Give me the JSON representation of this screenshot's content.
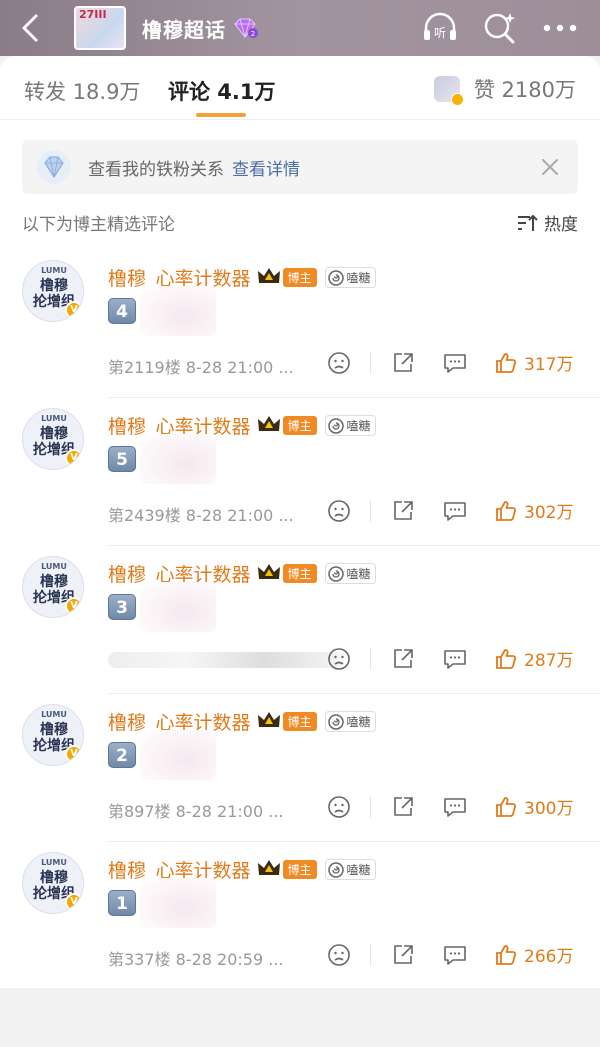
{
  "header": {
    "thumb_text": "27III",
    "title": "橹穆超话",
    "icons": [
      "back-arrow-icon",
      "listen-icon",
      "search-sparkle-icon",
      "more-icon"
    ],
    "listen_label": "听"
  },
  "tabs": {
    "repost": "转发 18.9万",
    "comment": "评论 4.1万",
    "likes": "赞 2180万"
  },
  "notice": {
    "text": "查看我的铁粉关系",
    "link": "查看详情"
  },
  "sort": {
    "hint": "以下为博主精选评论",
    "label": "热度"
  },
  "comments": [
    {
      "name": "橹穆_心率计数器",
      "tag": "博主",
      "candy": "嗑糖",
      "num": "4",
      "meta": "第2119楼 8-28 21:00 ...",
      "likes": "317万",
      "blurred": false
    },
    {
      "name": "橹穆_心率计数器",
      "tag": "博主",
      "candy": "嗑糖",
      "num": "5",
      "meta": "第2439楼 8-28 21:00 ...",
      "likes": "302万",
      "blurred": false
    },
    {
      "name": "橹穆_心率计数器",
      "tag": "博主",
      "candy": "嗑糖",
      "num": "3",
      "meta": "第",
      "likes": "287万",
      "blurred": true
    },
    {
      "name": "橹穆_心率计数器",
      "tag": "博主",
      "candy": "嗑糖",
      "num": "2",
      "meta": "第897楼 8-28 21:00 ...",
      "likes": "300万",
      "blurred": false
    },
    {
      "name": "橹穆_心率计数器",
      "tag": "博主",
      "candy": "嗑糖",
      "num": "1",
      "meta": "第337楼 8-28 20:59 ...",
      "likes": "266万",
      "blurred": false
    }
  ],
  "avatar": {
    "lumu": "LUMU",
    "line1": "橹穆",
    "line2": "抡增组"
  },
  "colors": {
    "accent": "#e07b1a",
    "link": "#4c6ea3",
    "tab_underline": "#f3a23b"
  }
}
